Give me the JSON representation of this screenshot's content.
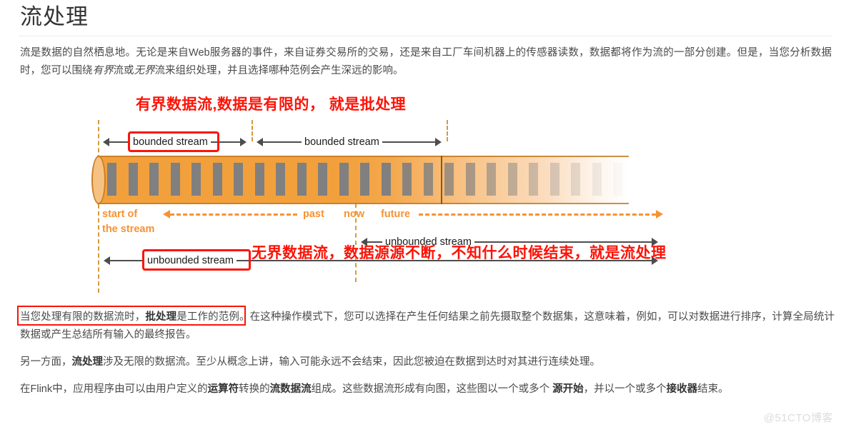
{
  "page": {
    "title": "流处理",
    "intro_line1": "流是数据的自然栖息地。无论是来自Web服务器的事件，来自证券交易所的交易，还是来自工厂车间机器上的传感器读数，数据都将作为",
    "intro_line2_a": "流的一部分创建。但是，当您分析数据时，您可以围绕",
    "intro_em1": "有界",
    "intro_line2_b": "流或",
    "intro_em2": "无界",
    "intro_line2_c": "流来组织处理，并且选择哪种范例会产生深远的影响。"
  },
  "figure": {
    "annotation_top": "有界数据流,数据是有限的， 就是批处理",
    "annotation_bottom": "无界数据流，数据源源不断，不知什么时候结束，就是流处理",
    "bounded_label_1": "bounded stream",
    "bounded_label_2": "bounded stream",
    "unbounded_label_1": "unbounded stream",
    "unbounded_label_2": "unbounded stream",
    "timeline_start_line1": "start of",
    "timeline_start_line2": "the stream",
    "timeline_past": "past",
    "timeline_now": "now",
    "timeline_future": "future",
    "colors": {
      "annotation_red": "#fc1408",
      "pipe_orange": "#f2a03c",
      "pipe_border": "#c27c24",
      "timeline_orange": "#f79232",
      "tick_gray": "#808080",
      "arrow_dark": "#4d4d4d"
    }
  },
  "body": {
    "para1_a": "当您处理有限的数据流时，",
    "para1_bold": "批处理",
    "para1_b": "是工作的范例。在这种操作模式下，您可以选择在产生任何结果之前先摄取整个数据集，这意味着，例如，可以对数据进行排序，计算全局统计数据或产生总结所有输入的最终报告。",
    "para2_a": "另一方面，",
    "para2_bold": "流处理",
    "para2_b": "涉及无限的数据流。至少从概念上讲，输入可能永远不会结束，因此您被迫在数据到达时对其进行连续处理。",
    "para3_a": "在Flink中，应用程序由可以由用户定义的",
    "para3_bold1": "运算符",
    "para3_b": "转换的",
    "para3_bold2": "流数据流",
    "para3_c": "组成。这些数据流形成有向图，这些图以一个或多个 ",
    "para3_bold3": "源开始",
    "para3_d": "，并以一个或多个",
    "para3_bold4": "接收器",
    "para3_e": "结束。"
  },
  "watermark": "@51CTO博客"
}
